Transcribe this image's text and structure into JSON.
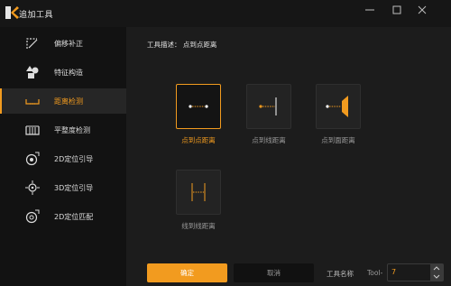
{
  "window": {
    "title": "追加工具"
  },
  "sidebar": {
    "items": [
      {
        "label": "偏移补正",
        "icon": "offset-correction-icon"
      },
      {
        "label": "特征构造",
        "icon": "feature-construct-icon"
      },
      {
        "label": "距离检测",
        "icon": "distance-detect-icon",
        "active": true
      },
      {
        "label": "平整度检测",
        "icon": "flatness-detect-icon"
      },
      {
        "label": "2D定位引导",
        "icon": "2d-guide-icon"
      },
      {
        "label": "3D定位引导",
        "icon": "3d-guide-icon"
      },
      {
        "label": "2D定位匹配",
        "icon": "2d-match-icon"
      }
    ]
  },
  "main": {
    "description": "工具描述：  点到点距离",
    "tools": [
      {
        "label": "点到点距离",
        "icon": "point-to-point-icon",
        "selected": true
      },
      {
        "label": "点到线距离",
        "icon": "point-to-line-icon"
      },
      {
        "label": "点到面距离",
        "icon": "point-to-plane-icon"
      },
      {
        "label": "线到线距离",
        "icon": "line-to-line-icon"
      }
    ]
  },
  "footer": {
    "ok_label": "确定",
    "cancel_label": "取消",
    "tool_name_label": "工具名称",
    "tool_name_prefix": "Tool-",
    "tool_name_value": "7"
  },
  "colors": {
    "accent": "#f29b1f",
    "background": "#1c1c1c",
    "sidebar": "#121212"
  }
}
